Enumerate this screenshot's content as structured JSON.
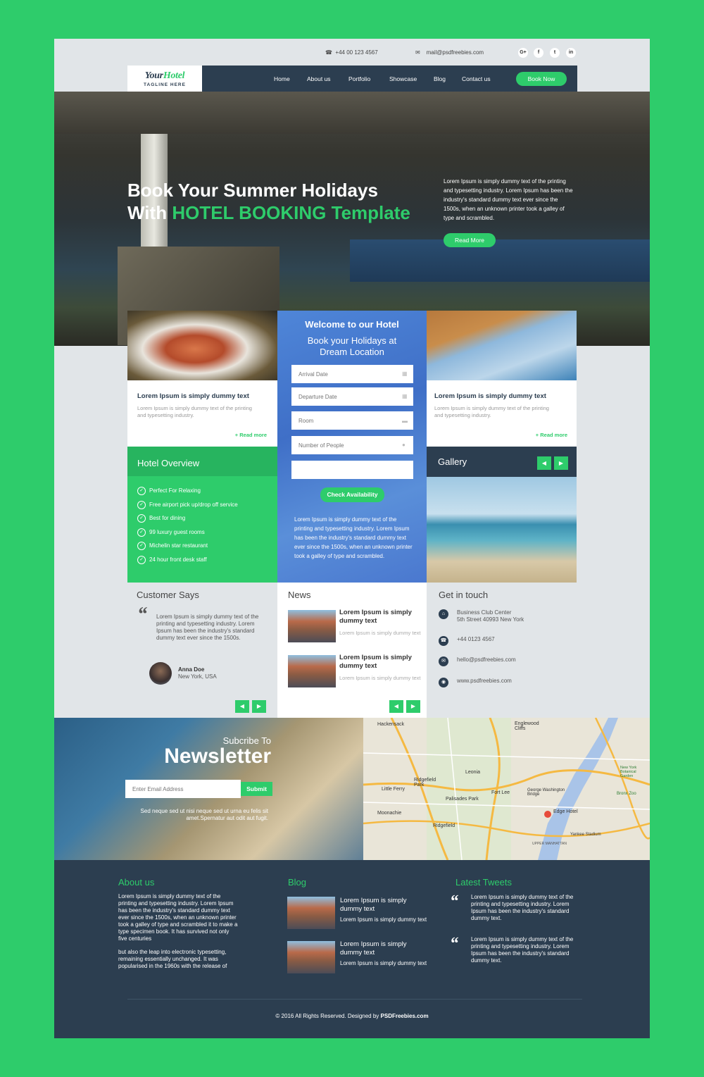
{
  "topbar": {
    "phone": "+44 00 123 4567",
    "email": "mail@psdfreebies.com",
    "social": [
      "G+",
      "f",
      "t",
      "in"
    ]
  },
  "logo": {
    "your": "Your",
    "hotel": "Hotel",
    "tagline": "TAGLINE HERE"
  },
  "nav": {
    "items": [
      "Home",
      "About us",
      "Portfolio",
      "Showcase",
      "Blog",
      "Contact us"
    ],
    "book_now": "Book Now"
  },
  "hero": {
    "title_line1": "Book Your Summer Holidays",
    "title_line2_prefix": "With",
    "title_line2_highlight": "HOTEL BOOKING Template",
    "text": "Lorem Ipsum is simply dummy text of the printing and typesetting industry. Lorem Ipsum has been the industry's standard dummy text ever since the 1500s, when an unknown printer took a galley of type and scrambled.",
    "read_more": "Read More"
  },
  "cards": [
    {
      "title": "Lorem Ipsum is simply dummy text",
      "text": "Lorem Ipsum is simply dummy text of the printing and typesetting industry.",
      "link": "+ Read more"
    },
    {
      "title": "Lorem Ipsum is simply dummy text",
      "text": "Lorem Ipsum is simply dummy text of the printing and typesetting industry.",
      "link": "+ Read more"
    }
  ],
  "booking": {
    "welcome": "Welcome to our Hotel",
    "sub1": "Book your Holidays at",
    "sub2": "Dream Location",
    "arrival": "Arrival Date",
    "departure": "Departure Date",
    "room": "Room",
    "people": "Number of People",
    "button": "Check Availability",
    "text": "Lorem Ipsum is simply dummy text of the printing and typesetting industry. Lorem Ipsum has been the industry's standard dummy text ever since the 1500s, when an unknown printer took a galley of type and scrambled."
  },
  "overview": {
    "title": "Hotel Overview",
    "items": [
      "Perfect For Relaxing",
      "Free airport pick up/drop off service",
      "Best for dining",
      "99 luxury guest rooms",
      "Michelin star restaurant",
      "24 hour front desk staff"
    ]
  },
  "gallery": {
    "title": "Gallery"
  },
  "customer": {
    "title": "Customer Says",
    "quote": "Lorem Ipsum is simply dummy text of the printing and typesetting industry. Lorem Ipsum has been the industry's standard dummy text ever since the 1500s.",
    "name": "Anna Doe",
    "location": "New York, USA"
  },
  "news": {
    "title": "News",
    "items": [
      {
        "title": "Lorem Ipsum is simply dummy text",
        "text": "Lorem Ipsum is simply dummy text"
      },
      {
        "title": "Lorem Ipsum is simply dummy text",
        "text": "Lorem Ipsum is simply dummy text"
      }
    ]
  },
  "contact": {
    "title": "Get in touch",
    "address1": "Business Club Center",
    "address2": "5th Street 40993 New York",
    "phone": "+44 0123 4567",
    "email": "hello@psdfreebies.com",
    "web": "www.psdfreebies.com"
  },
  "newsletter": {
    "sub": "Subcribe To",
    "title": "Newsletter",
    "placeholder": "Enter Email Address",
    "button": "Submit",
    "text": "Sed neque sed ut nisi neque sed ut urna eu felis sit amet.Spernatur aut odit aut fugit."
  },
  "map": {
    "labels": [
      "Hackensack",
      "Englewood Cliffs",
      "Leonia",
      "Ridgefield Park",
      "Little Ferry",
      "Palisades Park",
      "Fort Lee",
      "Moonachie",
      "Ridgefield",
      "Edge Hotel",
      "Yankee Stadium",
      "New York Botanical Garden",
      "Bronx Zoo",
      "George Washington Bridge",
      "UPPER MANHATTAN"
    ]
  },
  "footer": {
    "about_title": "About us",
    "about_text1": "Lorem Ipsum is simply dummy text of the printing and typesetting industry. Lorem Ipsum has been the industry's standard dummy text ever since the 1500s, when an unknown printer took a galley of type and scrambled it to make a type specimen book. It has survived not only five centuries",
    "about_text2": "but also the leap into electronic typesetting, remaining essentially unchanged. It was popularised in the 1960s with the release of",
    "blog_title": "Blog",
    "blog": [
      {
        "title": "Lorem Ipsum is simply dummy text",
        "text": "Lorem Ipsum is simply dummy text"
      },
      {
        "title": "Lorem Ipsum is simply dummy text",
        "text": "Lorem Ipsum is simply dummy text"
      }
    ],
    "tweets_title": "Latest Tweets",
    "tweets": [
      "Lorem Ipsum is simply dummy text of the printing and typesetting industry. Lorem Ipsum has been the industry's standard dummy text.",
      "Lorem Ipsum is simply dummy text of the printing and typesetting industry. Lorem Ipsum has been the industry's standard dummy text."
    ],
    "copyright": "© 2016 All Rights Reserved. Designed by",
    "designer": "PSDFreebies.com"
  }
}
